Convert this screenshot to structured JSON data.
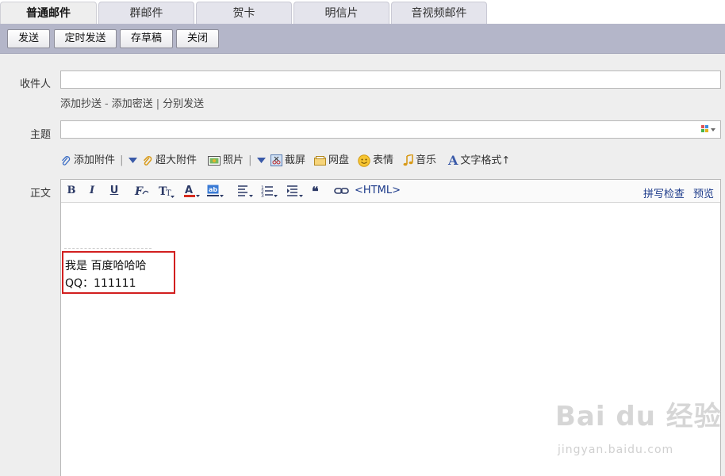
{
  "tabs": [
    {
      "label": "普通邮件",
      "active": true
    },
    {
      "label": "群邮件"
    },
    {
      "label": "贺卡"
    },
    {
      "label": "明信片"
    },
    {
      "label": "音视频邮件"
    }
  ],
  "toolbar": {
    "send": "发送",
    "scheduled_send": "定时发送",
    "save_draft": "存草稿",
    "close": "关闭"
  },
  "recipient": {
    "label": "收件人",
    "value": "",
    "add_cc": "添加抄送",
    "dash": "-",
    "add_bcc": "添加密送",
    "pipe": "|",
    "separate_send": "分别发送"
  },
  "subject": {
    "label": "主题",
    "value": ""
  },
  "attachments": {
    "add_attachment": "添加附件",
    "large_attachment": "超大附件",
    "photo": "照片",
    "screenshot": "截屏",
    "netdisk": "网盘",
    "emoji": "表情",
    "music": "音乐",
    "text_format": "文字格式↑"
  },
  "editor": {
    "label": "正文",
    "bold": "B",
    "italic": "I",
    "underline": "U",
    "html": "<HTML>",
    "spellcheck": "拼写检查",
    "preview": "预览",
    "body_line1": "我是 百度哈哈哈",
    "body_line2": "QQ：111111"
  },
  "watermark": {
    "logo": "Bai du 经验",
    "url": "jingyan.baidu.com"
  },
  "colors": {
    "toolbar_bg": "#b4b6c9",
    "highlight_border": "#d21f1f",
    "link_blue": "#1c3a8a"
  }
}
